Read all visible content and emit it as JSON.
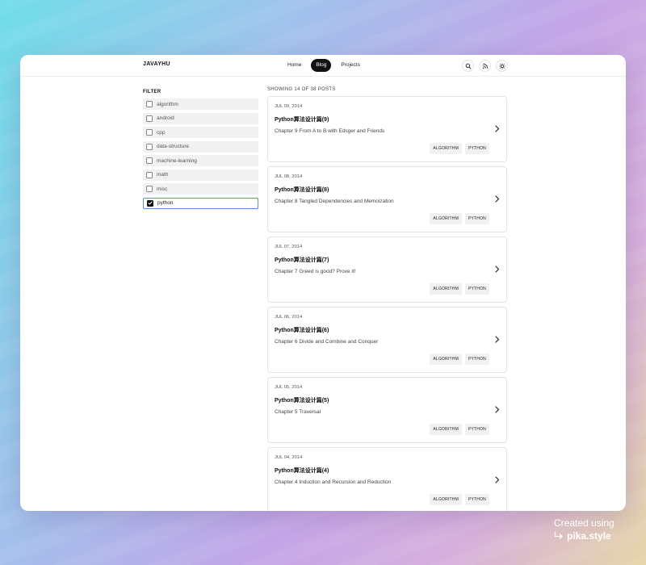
{
  "header": {
    "brand": "JAVAYHU",
    "nav": [
      "Home",
      "Blog",
      "Projects"
    ],
    "active_nav": "Blog",
    "icons": [
      "search-icon",
      "rss-icon",
      "theme-toggle-icon"
    ]
  },
  "filter": {
    "title": "FILTER",
    "items": [
      {
        "label": "algorithm",
        "checked": false
      },
      {
        "label": "android",
        "checked": false
      },
      {
        "label": "cpp",
        "checked": false
      },
      {
        "label": "data-structure",
        "checked": false
      },
      {
        "label": "machine-learning",
        "checked": false
      },
      {
        "label": "math",
        "checked": false
      },
      {
        "label": "misc",
        "checked": false
      },
      {
        "label": "python",
        "checked": true
      }
    ]
  },
  "posts": {
    "showing": "SHOWING 14 OF 38 POSTS",
    "items": [
      {
        "date": "JUL 09, 2014",
        "title": "Python算法设计篇(9)",
        "subtitle": "Chapter 9 From A to B with Edsger and Friends",
        "tags": [
          "ALGORITHM",
          "PYTHON"
        ]
      },
      {
        "date": "JUL 08, 2014",
        "title": "Python算法设计篇(8)",
        "subtitle": "Chapter 8 Tangled Dependencies and Memoization",
        "tags": [
          "ALGORITHM",
          "PYTHON"
        ]
      },
      {
        "date": "JUL 07, 2014",
        "title": "Python算法设计篇(7)",
        "subtitle": "Chapter 7 Greed is good? Prove it!",
        "tags": [
          "ALGORITHM",
          "PYTHON"
        ]
      },
      {
        "date": "JUL 06, 2014",
        "title": "Python算法设计篇(6)",
        "subtitle": "Chapter 6 Divide and Combine and Conquer",
        "tags": [
          "ALGORITHM",
          "PYTHON"
        ]
      },
      {
        "date": "JUL 05, 2014",
        "title": "Python算法设计篇(5)",
        "subtitle": "Chapter 5 Traversal",
        "tags": [
          "ALGORITHM",
          "PYTHON"
        ]
      },
      {
        "date": "JUL 04, 2014",
        "title": "Python算法设计篇(4)",
        "subtitle": "Chapter 4 Induction and Recursion and Reduction",
        "tags": [
          "ALGORITHM",
          "PYTHON"
        ]
      }
    ]
  },
  "watermark": {
    "line1": "Created using",
    "line2": "pika.style"
  }
}
